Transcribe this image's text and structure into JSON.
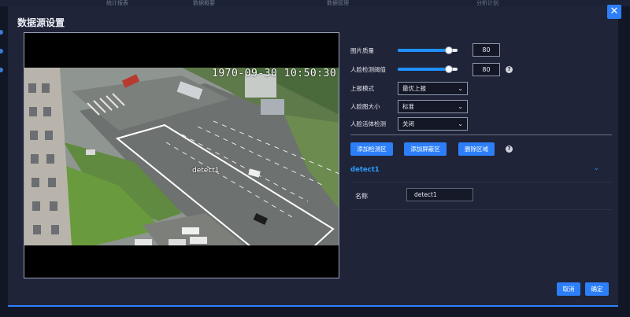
{
  "background": {
    "tabs": [
      "统计报表",
      "数据概要",
      "数据管理",
      "分析计划"
    ]
  },
  "modal": {
    "title": "数据源设置",
    "close_icon": "close-icon"
  },
  "video": {
    "timestamp": "1970-09-30 10:50:30",
    "detect_label": "detect1"
  },
  "settings": {
    "image_quality": {
      "label": "图片质量",
      "value": "80",
      "percent": 80
    },
    "face_threshold": {
      "label": "人脸检测阈值",
      "value": "80",
      "percent": 80
    },
    "report_mode": {
      "label": "上报模式",
      "value": "最优上报"
    },
    "face_frame_size": {
      "label": "人脸图大小",
      "value": "标准"
    },
    "liveness": {
      "label": "人脸活体检测",
      "value": "关闭"
    }
  },
  "actions": {
    "add_detect": "添加检测区",
    "add_mask": "添加屏蔽区",
    "delete_region": "删除区域"
  },
  "region": {
    "title": "detect1",
    "name_label": "名称",
    "name_value": "detect1"
  },
  "footer": {
    "cancel": "取消",
    "confirm": "确定"
  },
  "colors": {
    "accent": "#2d7ff9",
    "panel": "#1f2438",
    "slider_fill": "#1e90ff"
  }
}
